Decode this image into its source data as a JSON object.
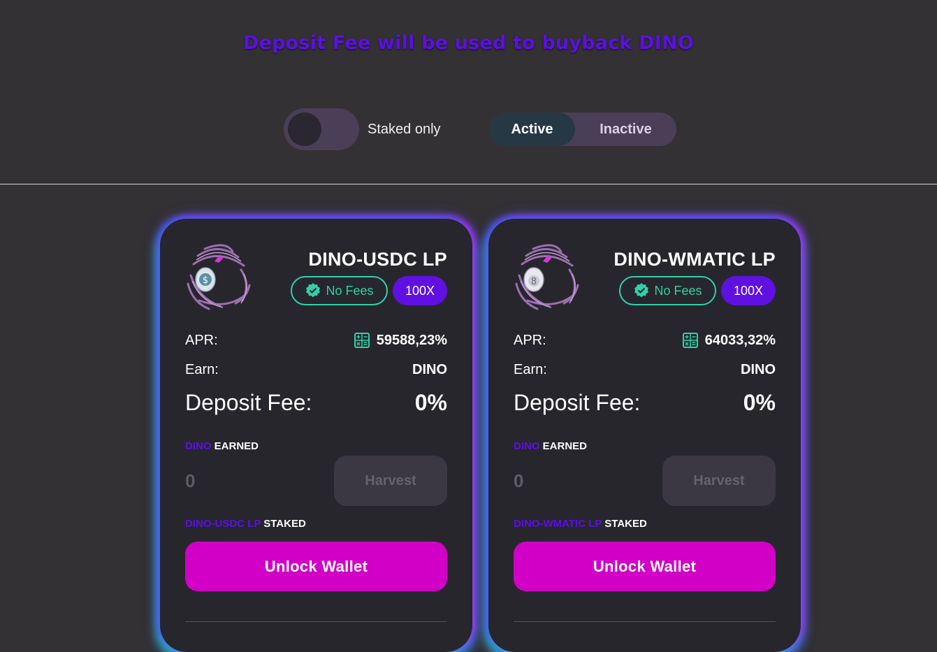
{
  "banner": "Deposit Fee will be used to buyback DINO",
  "filters": {
    "staked_only_label": "Staked only",
    "tab_active": "Active",
    "tab_inactive": "Inactive"
  },
  "colors": {
    "accent_purple": "#5b10e0",
    "no_fee_green": "#31d0aa",
    "unlock_magenta": "#d200c6"
  },
  "farms": [
    {
      "title": "DINO-USDC LP",
      "badge_no_fees": "No Fees",
      "multiplier": "100X",
      "apr_label": "APR:",
      "apr_value": "59588,23%",
      "earn_label": "Earn:",
      "earn_value": "DINO",
      "fee_label": "Deposit Fee:",
      "fee_value": "0%",
      "earned_token": "DINO",
      "earned_suffix": "EARNED",
      "earned_amount": "0",
      "harvest_label": "Harvest",
      "staked_token": "DINO-USDC LP",
      "staked_suffix": "STAKED",
      "unlock_label": "Unlock Wallet",
      "coin_glyph": "$",
      "token_icon": "dino-egg-dollar-icon"
    },
    {
      "title": "DINO-WMATIC LP",
      "badge_no_fees": "No Fees",
      "multiplier": "100X",
      "apr_label": "APR:",
      "apr_value": "64033,32%",
      "earn_label": "Earn:",
      "earn_value": "DINO",
      "fee_label": "Deposit Fee:",
      "fee_value": "0%",
      "earned_token": "DINO",
      "earned_suffix": "EARNED",
      "earned_amount": "0",
      "harvest_label": "Harvest",
      "staked_token": "DINO-WMATIC LP",
      "staked_suffix": "STAKED",
      "unlock_label": "Unlock Wallet",
      "coin_glyph": "8",
      "token_icon": "dino-egg-matic-icon"
    }
  ]
}
